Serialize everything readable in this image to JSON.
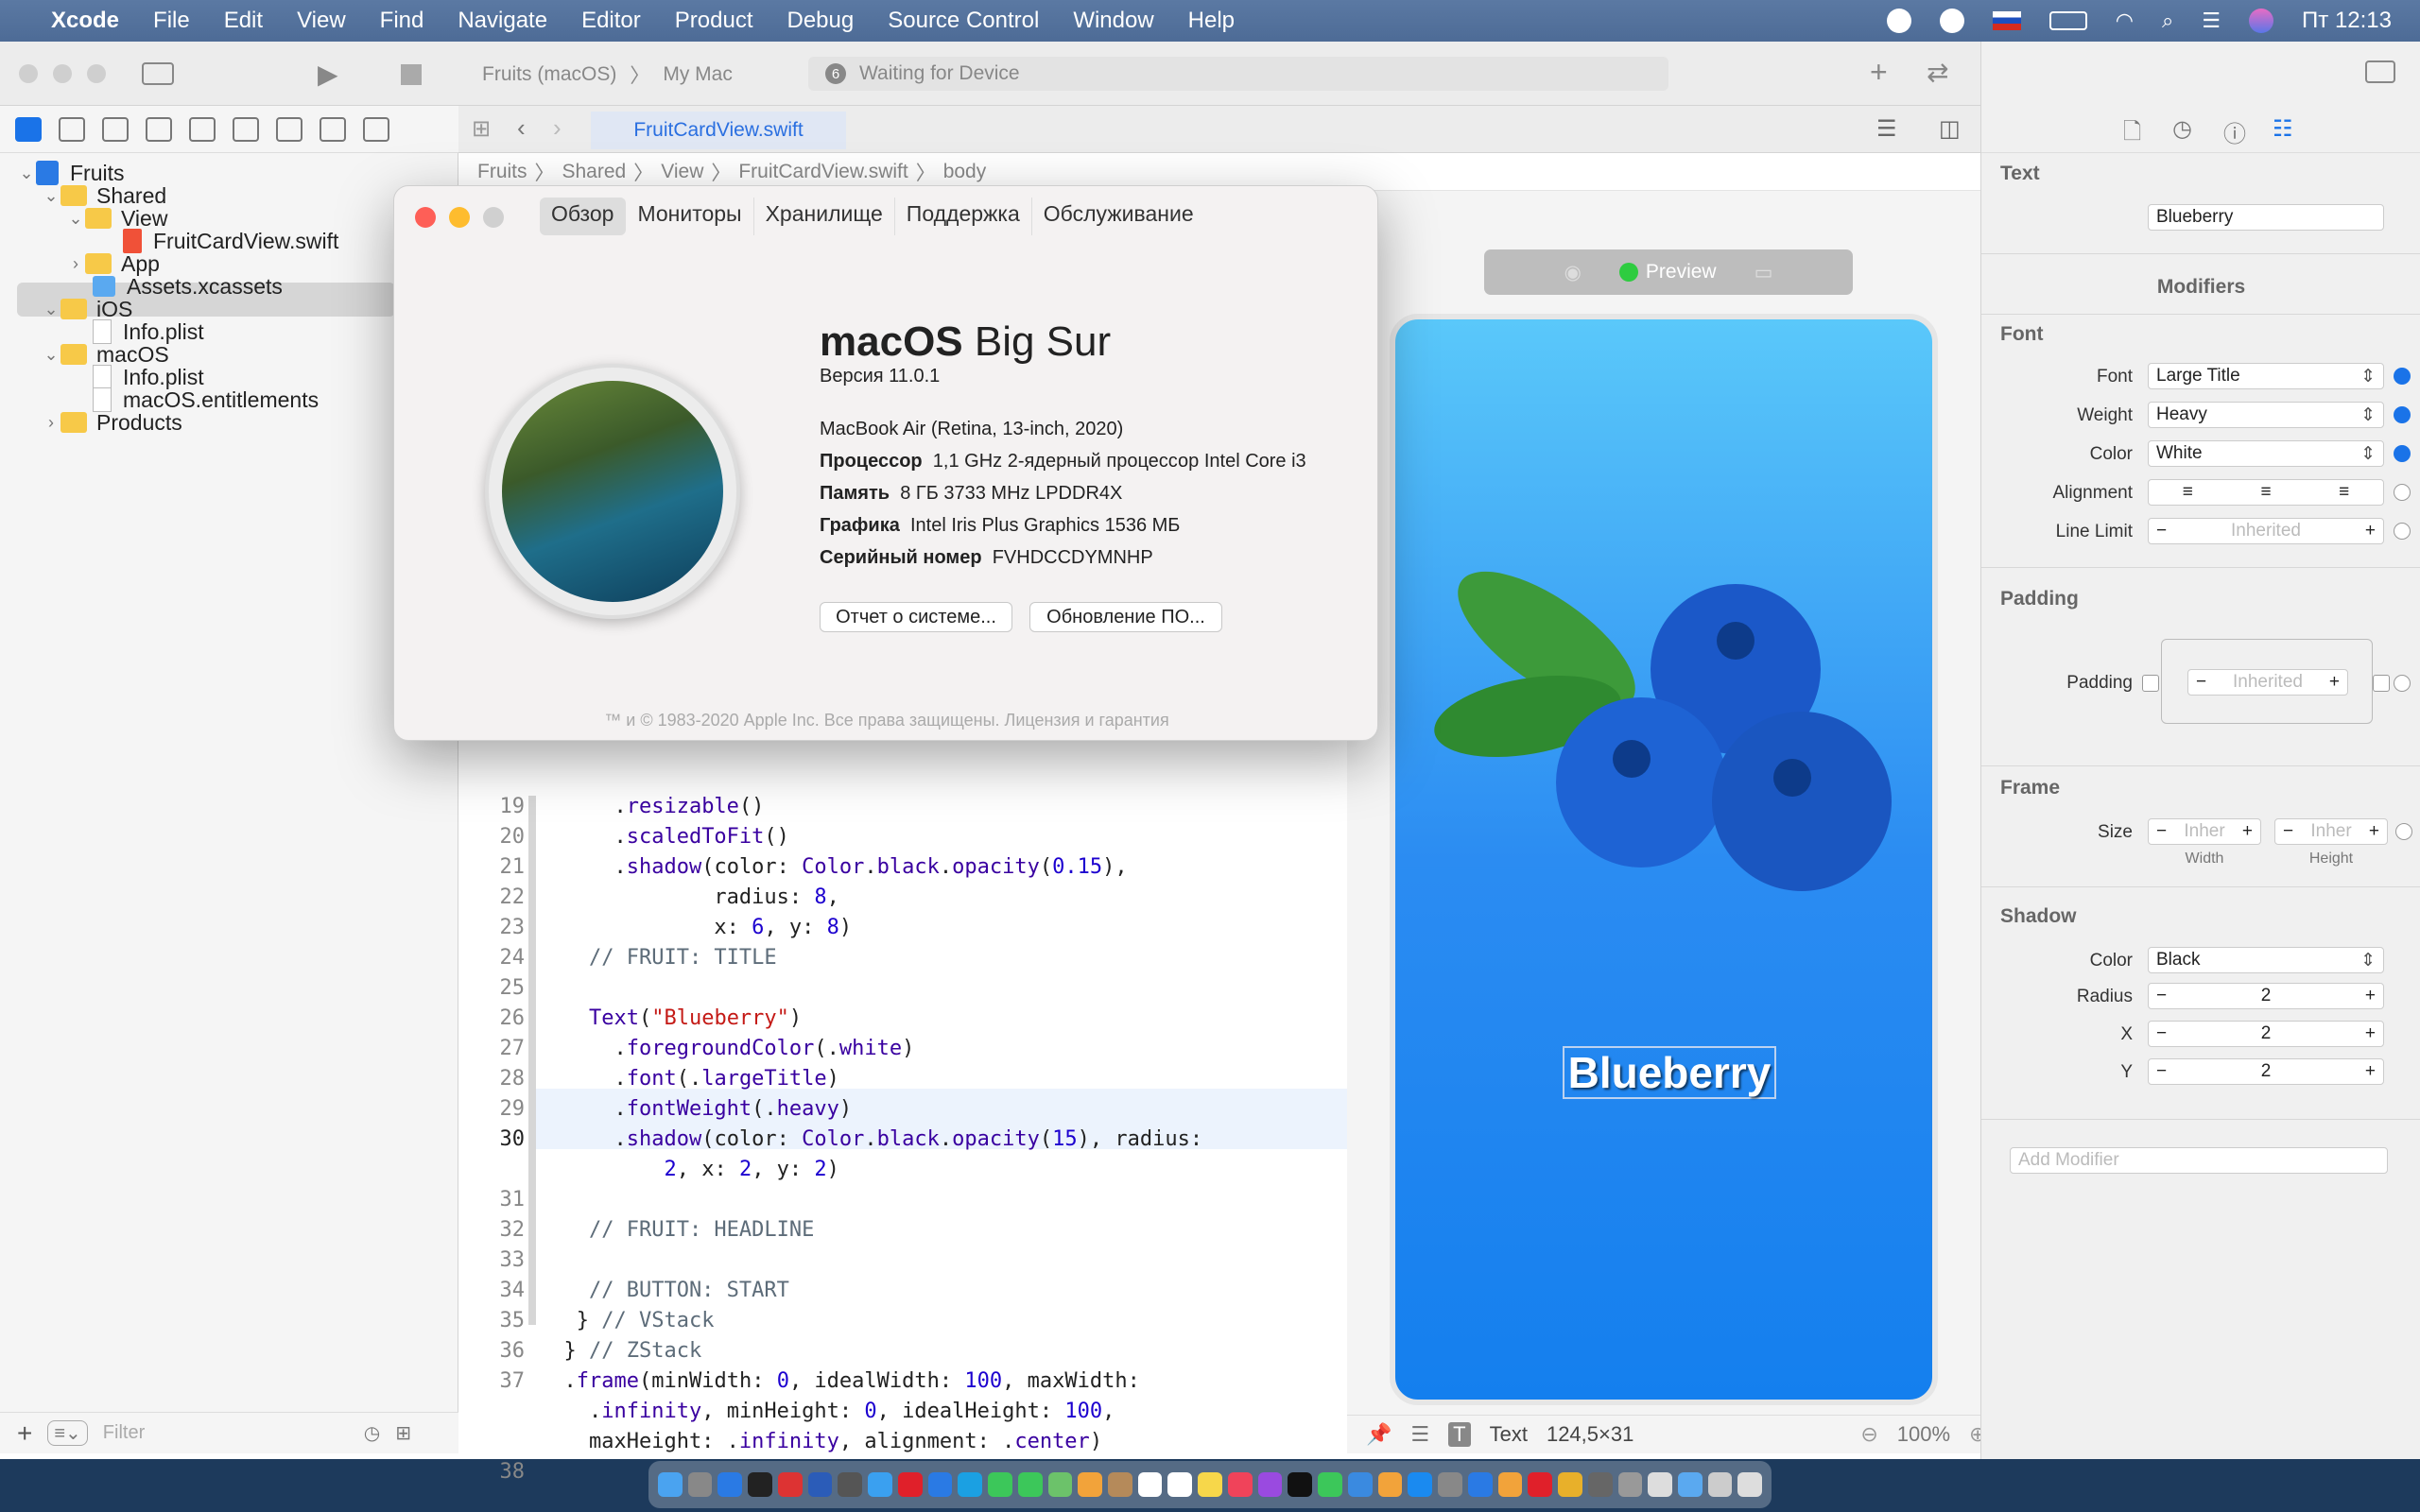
{
  "menubar": {
    "app": "Xcode",
    "items": [
      "File",
      "Edit",
      "View",
      "Find",
      "Navigate",
      "Editor",
      "Product",
      "Debug",
      "Source Control",
      "Window",
      "Help"
    ],
    "clock": "Пт 12:13"
  },
  "toolbar": {
    "scheme": "Fruits (macOS)",
    "destination": "My Mac",
    "status_badge": "6",
    "status": "Waiting for Device"
  },
  "navigator": {
    "items": [
      {
        "label": "Fruits"
      },
      {
        "label": "Shared"
      },
      {
        "label": "View"
      },
      {
        "label": "FruitCardView.swift"
      },
      {
        "label": "App"
      },
      {
        "label": "Assets.xcassets"
      },
      {
        "label": "iOS"
      },
      {
        "label": "Info.plist"
      },
      {
        "label": "macOS"
      },
      {
        "label": "Info.plist"
      },
      {
        "label": "macOS.entitlements"
      },
      {
        "label": "Products"
      }
    ],
    "filter_placeholder": "Filter"
  },
  "editor": {
    "tab": "FruitCardView.swift",
    "breadcrumb": [
      "Fruits",
      "Shared",
      "View",
      "FruitCardView.swift",
      "body"
    ],
    "line_numbers": [
      "19",
      "20",
      "21",
      "22",
      "23",
      "24",
      "25",
      "26",
      "27",
      "28",
      "29",
      "30",
      "",
      "31",
      "32",
      "33",
      "34",
      "35",
      "36",
      "37",
      "",
      "",
      "38"
    ]
  },
  "canvas": {
    "preview_label": "Preview",
    "preview_text": "Blueberry",
    "footer_item": "Text",
    "footer_size": "124,5×31",
    "zoom": "100%"
  },
  "inspector": {
    "text_header": "Text",
    "text_value": "Blueberry",
    "modifiers_header": "Modifiers",
    "font_header": "Font",
    "font_label": "Font",
    "font_value": "Large Title",
    "weight_label": "Weight",
    "weight_value": "Heavy",
    "color_label": "Color",
    "color_value": "White",
    "alignment_label": "Alignment",
    "line_limit_label": "Line Limit",
    "line_limit_value": "Inherited",
    "padding_header": "Padding",
    "padding_label": "Padding",
    "padding_value": "Inherited",
    "frame_header": "Frame",
    "size_label": "Size",
    "size_w_value": "Inher",
    "size_h_value": "Inher",
    "width_caption": "Width",
    "height_caption": "Height",
    "shadow_header": "Shadow",
    "shadow_color_label": "Color",
    "shadow_color_value": "Black",
    "radius_label": "Radius",
    "radius_value": "2",
    "x_label": "X",
    "x_value": "2",
    "y_label": "Y",
    "y_value": "2",
    "add_modifier_placeholder": "Add Modifier"
  },
  "about": {
    "tabs": [
      "Обзор",
      "Мониторы",
      "Хранилище",
      "Поддержка",
      "Обслуживание"
    ],
    "title_bold": "macOS",
    "title_rest": " Big Sur",
    "version": "Версия 11.0.1",
    "model": "MacBook Air (Retina, 13-inch, 2020)",
    "cpu_label": "Процессор",
    "cpu_value": "1,1 GHz 2-ядерный процессор Intel Core i3",
    "mem_label": "Память",
    "mem_value": "8 ГБ 3733 MHz LPDDR4X",
    "gpu_label": "Графика",
    "gpu_value": "Intel Iris Plus Graphics 1536 МБ",
    "serial_label": "Серийный номер",
    "serial_value": "FVHDCCDYMNHP",
    "btn_report": "Отчет о системе...",
    "btn_update": "Обновление ПО...",
    "footer": "™ и © 1983-2020 Apple Inc. Все права защищены. Лицензия и гарантия"
  },
  "colors": {
    "accent": "#1a73e8",
    "preview_top": "#5ac8fa",
    "preview_bottom": "#147fee"
  }
}
